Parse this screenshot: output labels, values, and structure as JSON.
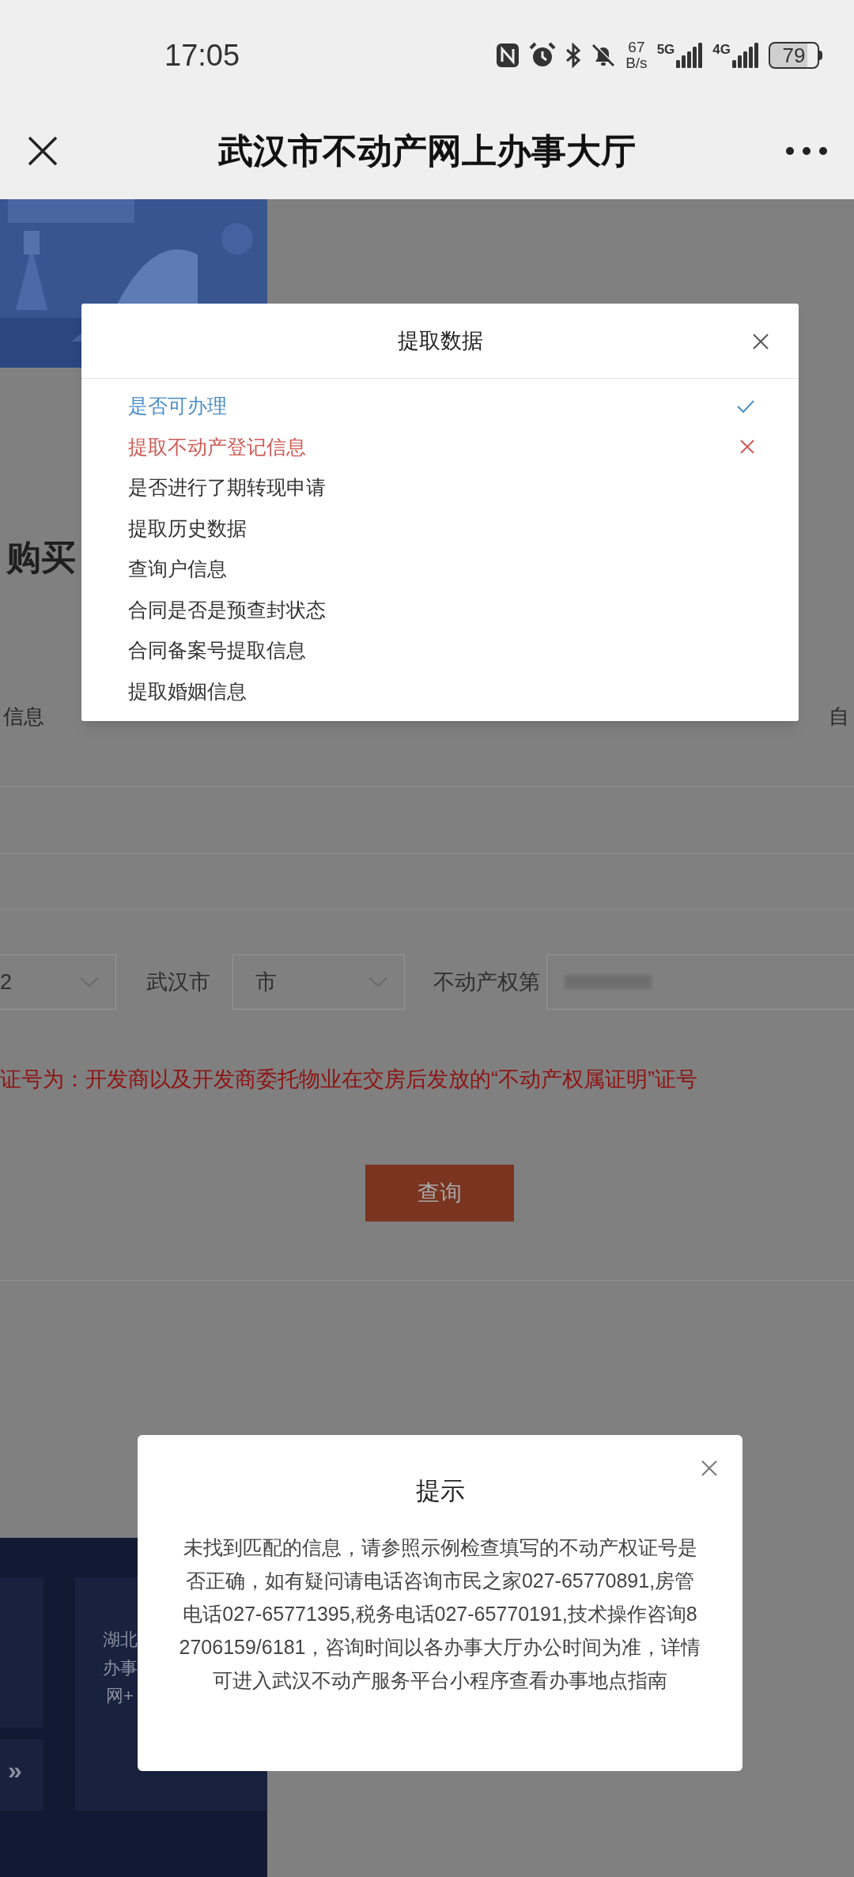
{
  "status_bar": {
    "time": "17:05",
    "network_speed": {
      "value": "67",
      "unit": "B/s"
    },
    "sim_1": "5G",
    "sim_2": "4G",
    "battery": "79"
  },
  "nav_bar": {
    "title": "武汉市不动产网上办事大厅"
  },
  "page": {
    "heading_fragment": "购买",
    "tab_fragments": [
      "信息",
      "自"
    ],
    "form": {
      "first_select": "2",
      "city_label": "武汉市",
      "district_select": "市",
      "certificate_label": "不动产权第"
    },
    "note": "证号为：开发商以及开发商委托物业在交房后发放的“不动产权属证明”证号",
    "query_button": "查询",
    "footer_fragments": [
      "湖北",
      "办事",
      "网+"
    ],
    "footer_more": "»"
  },
  "extract_dialog": {
    "title": "提取数据",
    "items": [
      {
        "label": "是否可办理",
        "passed": true,
        "failed": false
      },
      {
        "label": "提取不动产登记信息",
        "passed": false,
        "failed": true
      },
      {
        "label": "是否进行了期转现申请",
        "passed": false,
        "failed": false
      },
      {
        "label": "提取历史数据",
        "passed": false,
        "failed": false
      },
      {
        "label": "查询户信息",
        "passed": false,
        "failed": false
      },
      {
        "label": "合同是否是预查封状态",
        "passed": false,
        "failed": false
      },
      {
        "label": "合同备案号提取信息",
        "passed": false,
        "failed": false
      },
      {
        "label": "提取婚姻信息",
        "passed": false,
        "failed": false
      }
    ]
  },
  "notice_dialog": {
    "title": "提示",
    "message": "未找到匹配的信息，请参照示例检查填写的不动产权证号是否正确，如有疑问请电话咨询市民之家027-65770891,房管电话027-65771395,税务电话027-65770191,技术操作咨询82706159/6181，咨询时间以各办事大厅办公时间为准，详情可进入武汉不动产服务平台小程序查看办事地点指南"
  }
}
